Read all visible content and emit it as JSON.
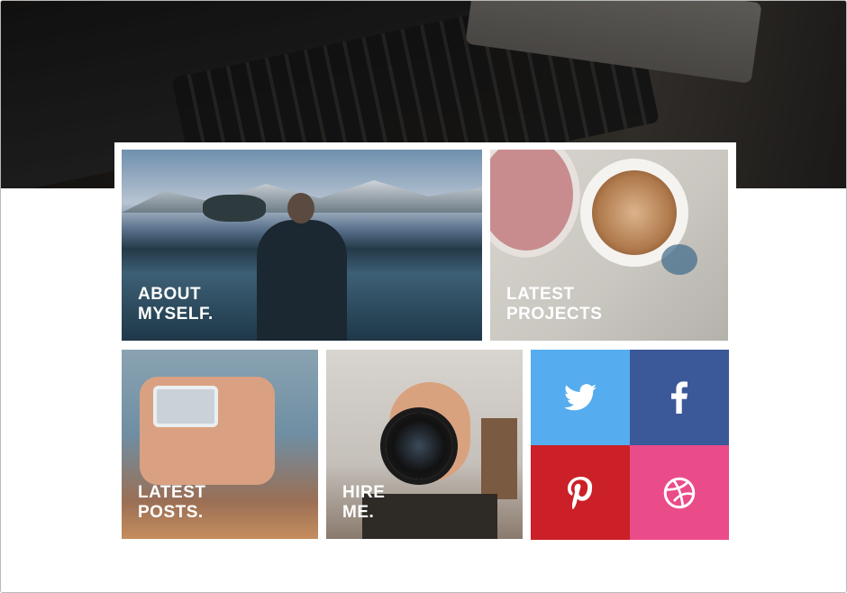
{
  "tiles": {
    "about": {
      "line1": "ABOUT",
      "line2": "MYSELF."
    },
    "projects": {
      "line1": "LATEST",
      "line2": "PROJECTS"
    },
    "posts": {
      "line1": "LATEST",
      "line2": "POSTS."
    },
    "hire": {
      "line1": "HIRE",
      "line2": "ME."
    }
  },
  "social": [
    {
      "name": "twitter",
      "icon": "twitter-icon",
      "color": "#55acee"
    },
    {
      "name": "facebook",
      "icon": "facebook-icon",
      "color": "#3b5998"
    },
    {
      "name": "pinterest",
      "icon": "pinterest-icon",
      "color": "#cb2027"
    },
    {
      "name": "dribbble",
      "icon": "dribbble-icon",
      "color": "#ea4c89"
    }
  ]
}
